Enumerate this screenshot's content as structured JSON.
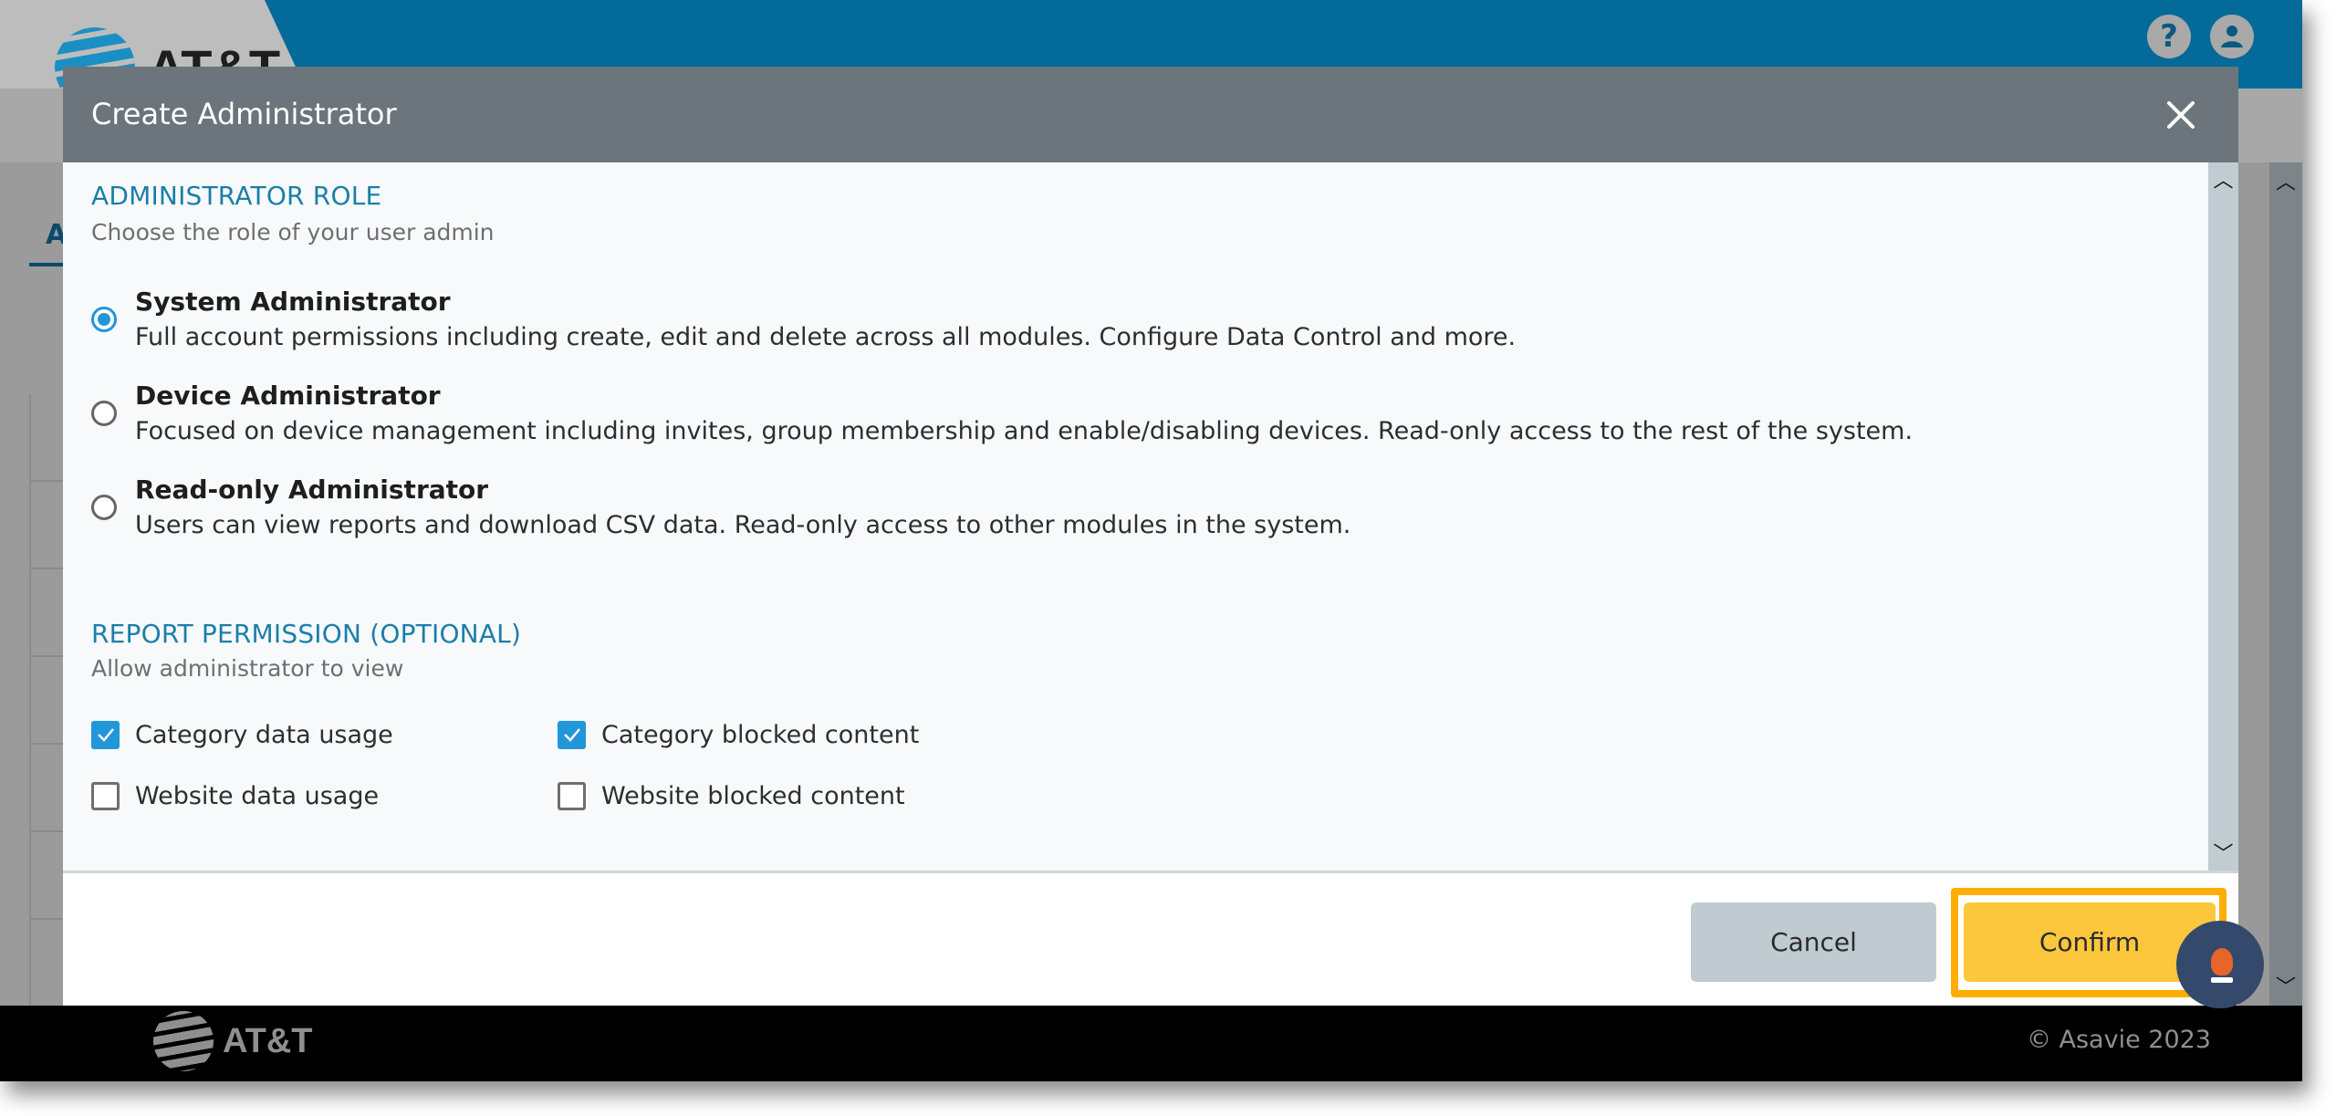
{
  "app": {
    "brand": "AT&T",
    "header_icons": [
      "help-icon",
      "account-icon"
    ],
    "background_tab_initial": "A",
    "footer": {
      "brand": "AT&T",
      "copyright": "© Asavie 2023"
    }
  },
  "modal": {
    "title": "Create Administrator",
    "close_icon": "close-icon",
    "role_section": {
      "title": "ADMINISTRATOR ROLE",
      "subtitle": "Choose the role of your user admin",
      "options": [
        {
          "label": "System Administrator",
          "description": "Full account permissions including create, edit and delete across all modules. Configure Data Control and more.",
          "selected": true
        },
        {
          "label": "Device Administrator",
          "description": "Focused on device management including invites, group membership and enable/disabling devices. Read-only access to the rest of the system.",
          "selected": false
        },
        {
          "label": "Read-only Administrator",
          "description": "Users can view reports and download CSV data. Read-only access to other modules in the system.",
          "selected": false
        }
      ]
    },
    "report_section": {
      "title": "REPORT PERMISSION (OPTIONAL)",
      "subtitle": "Allow administrator to view",
      "checkboxes": [
        {
          "label": "Category data usage",
          "checked": true
        },
        {
          "label": "Category blocked content",
          "checked": true
        },
        {
          "label": "Website data usage",
          "checked": false
        },
        {
          "label": "Website blocked content",
          "checked": false
        }
      ]
    },
    "buttons": {
      "cancel": "Cancel",
      "confirm": "Confirm"
    }
  },
  "colors": {
    "header_blue": "#046a99",
    "accent_blue": "#2196d8",
    "section_title": "#1a7fa8",
    "modal_title_bar": "#6b757b",
    "confirm_yellow": "#fcc73c",
    "highlight_orange": "#ffad00",
    "cancel_gray": "#bfcbd0",
    "chat_bubble": "#34496b"
  }
}
